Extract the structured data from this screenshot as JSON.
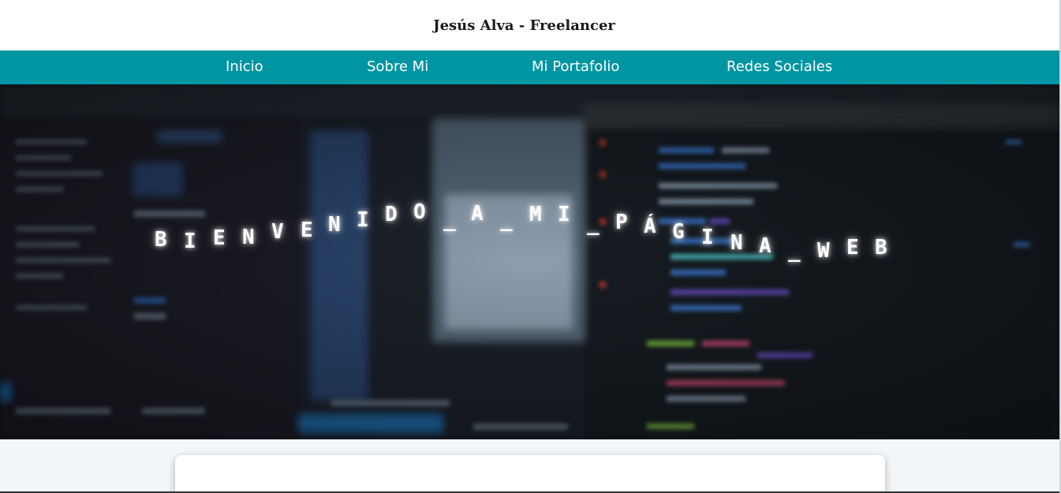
{
  "header": {
    "title": "Jesús Alva - Freelancer"
  },
  "nav": {
    "items": [
      {
        "label": "Inicio"
      },
      {
        "label": "Sobre Mi"
      },
      {
        "label": "Mi Portafolio"
      },
      {
        "label": "Redes Sociales"
      }
    ],
    "background": "#0095a3"
  },
  "hero": {
    "title_letters": [
      "B",
      "I",
      "E",
      "N",
      "V",
      "E",
      "N",
      "I",
      "D",
      "O",
      "_",
      "A",
      "_",
      "M",
      "I",
      "_",
      "P",
      "Á",
      "G",
      "I",
      "N",
      "A",
      "_",
      "W",
      "E",
      "B"
    ]
  },
  "colors": {
    "page_background": "#f3f6f9",
    "header_background": "#ffffff",
    "hero_text": "#ffffff"
  }
}
